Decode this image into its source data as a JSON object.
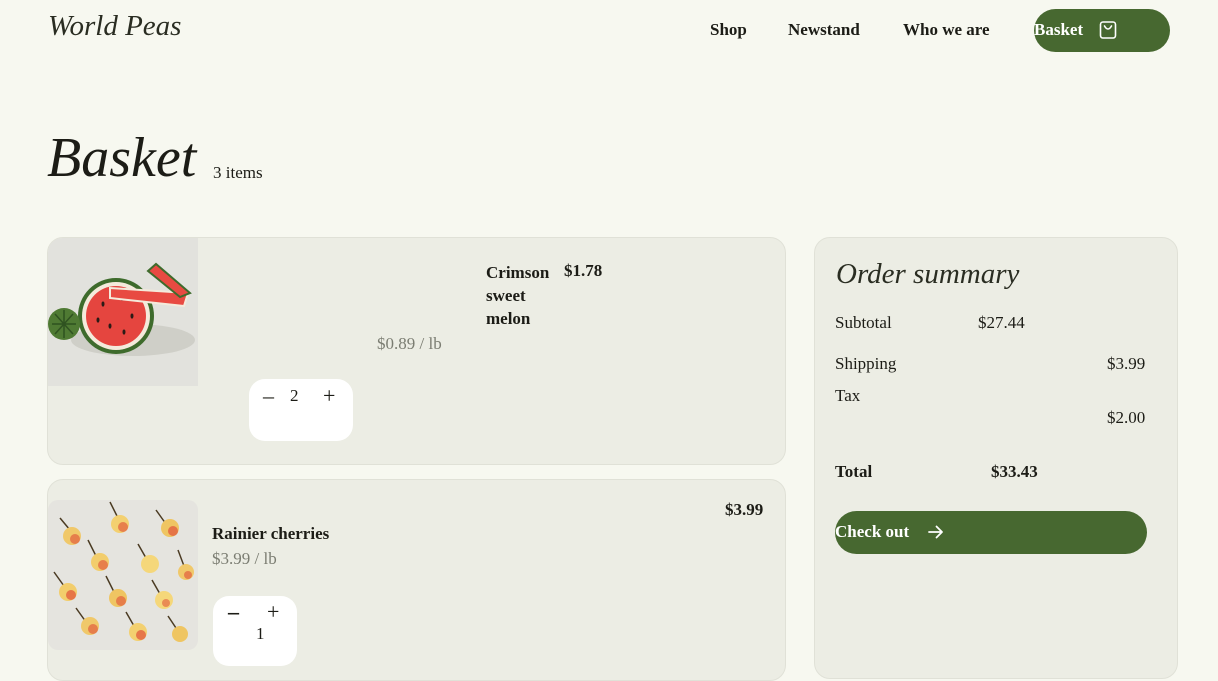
{
  "brand": {
    "logo_text": "World Peas"
  },
  "nav": {
    "links": [
      {
        "label": "Shop"
      },
      {
        "label": "Newstand"
      },
      {
        "label": "Who we are"
      }
    ],
    "basket_label": "Basket",
    "basket_icon": "shopping-bag-icon"
  },
  "page": {
    "title": "Basket",
    "item_count": "3 items"
  },
  "items": [
    {
      "name_lines": [
        "Crimson",
        "sweet",
        "melon"
      ],
      "price": "$1.78",
      "unit_price": "$0.89 / lb",
      "quantity": "2",
      "image": "watermelon-slices"
    },
    {
      "name": "Rainier cherries",
      "price": "$3.99",
      "unit_price": "$3.99 / lb",
      "quantity": "1",
      "image": "rainier-cherries"
    }
  ],
  "summary": {
    "title": "Order summary",
    "subtotal_label": "Subtotal",
    "subtotal_value": "$27.44",
    "shipping_label": "Shipping",
    "shipping_value": "$3.99",
    "tax_label": "Tax",
    "tax_value": "$2.00",
    "total_label": "Total",
    "total_value": "$33.43",
    "checkout_label": "Check out",
    "checkout_icon": "arrow-right-icon"
  },
  "colors": {
    "background": "#f7f8f0",
    "card": "#ecede4",
    "accent_green": "#476830",
    "muted_text": "#7b7d72"
  }
}
